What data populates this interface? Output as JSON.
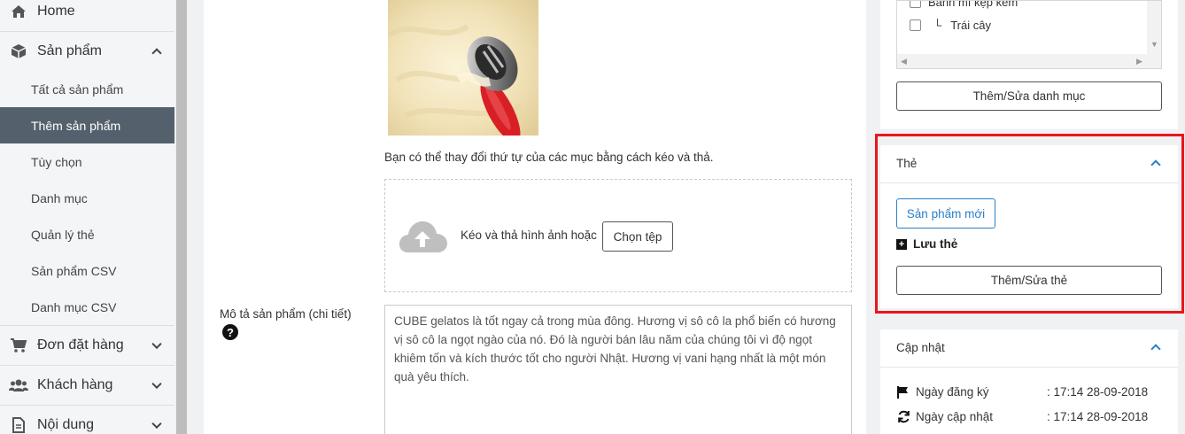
{
  "sidebar": {
    "home": "Home",
    "products": "Sản phẩm",
    "sub_items": [
      "Tất cả sản phẩm",
      "Thêm sản phẩm",
      "Tùy chọn",
      "Danh mục",
      "Quản lý thẻ",
      "Sản phẩm CSV",
      "Danh mục CSV"
    ],
    "orders": "Đơn đặt hàng",
    "customers": "Khách hàng",
    "content": "Nội dung"
  },
  "main": {
    "reorder_hint": "Bạn có thể thay đổi thứ tự của các mục bằng cách kéo và thả.",
    "drop_text": "Kéo và thả hình ảnh hoặc",
    "choose_file": "Chọn tệp",
    "description_label": "Mô tả sản phẩm (chi tiết)",
    "description_text": "CUBE gelatos là tốt ngay cả trong mùa đông. Hương vị sô cô la phổ biến có hương vị sô cô la ngọt ngào của nó. Đó là người bán lâu năm của chúng tôi vì độ ngọt khiêm tốn và kích thước tốt cho người Nhật. Hương vị vani hạng nhất là một món quà yêu thích."
  },
  "categories": {
    "items": [
      {
        "label": "Bánh mì kẹp kem",
        "checked": false
      },
      {
        "label": "Trái cây",
        "checked": false,
        "prefix": "└"
      }
    ],
    "edit_button": "Thêm/Sửa danh mục"
  },
  "tags": {
    "title": "Thẻ",
    "new_product_button": "Sản phẩm mới",
    "save_tag": "Lưu thẻ",
    "edit_button": "Thêm/Sửa thẻ"
  },
  "update": {
    "title": "Cập nhật",
    "registered_label": "Ngày đăng ký",
    "registered_value": ": 17:14 28-09-2018",
    "updated_label": "Ngày cập nhật",
    "updated_value": ": 17:14 28-09-2018"
  },
  "colors": {
    "accent": "#2a7fc9",
    "highlight": "#e8171c",
    "active_nav": "#54616d"
  }
}
